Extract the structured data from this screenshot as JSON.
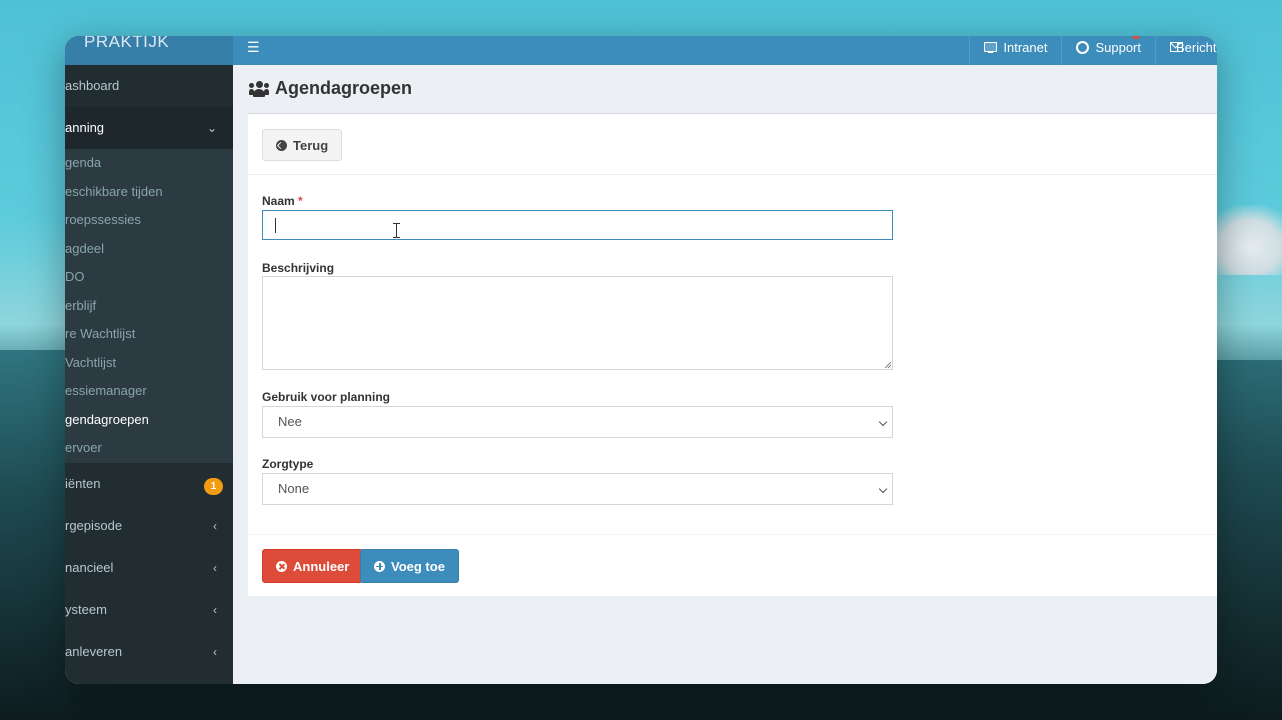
{
  "app": {
    "logo": "PRAKTIJK"
  },
  "topnav": {
    "intranet": "Intranet",
    "support": "Support",
    "messages": "Berichten"
  },
  "sidebar": {
    "dashboard": "ashboard",
    "planning": "anning",
    "sub": [
      "genda",
      "eschikbare tijden",
      "roepssessies",
      "agdeel",
      "DO",
      "erblijf",
      "re Wachtlijst",
      "Vachtlijst",
      "essiemanager",
      "gendagroepen",
      "ervoer"
    ],
    "clients": "iënten",
    "clients_badge": "1",
    "zorgepisode": "rgepisode",
    "financieel": "nancieel",
    "systeem": "ysteem",
    "aanleveren": "anleveren"
  },
  "page": {
    "title": "Agendagroepen"
  },
  "buttons": {
    "back": "Terug",
    "cancel": "Annuleer",
    "add": "Voeg toe"
  },
  "form": {
    "name_label": "Naam",
    "required_mark": "*",
    "name_value": "",
    "description_label": "Beschrijving",
    "description_value": "",
    "use_planning_label": "Gebruik voor planning",
    "use_planning_value": "Nee",
    "care_type_label": "Zorgtype",
    "care_type_value": "None"
  },
  "colors": {
    "header": "#3c8dbc",
    "sidebar": "#222d32",
    "danger": "#dd4b39",
    "badge": "#f39c12"
  }
}
